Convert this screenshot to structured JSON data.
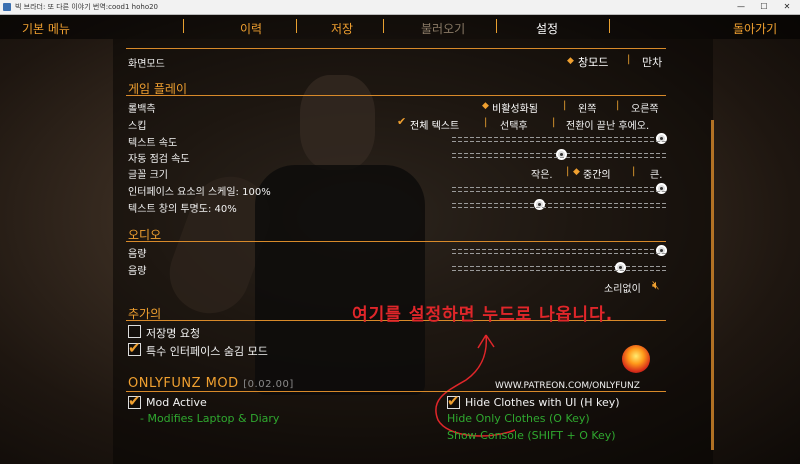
{
  "window": {
    "title": "빅 브라더: 또 다른 이야기  번역:cood1 hoho20",
    "minimize": "—",
    "maximize": "☐",
    "close": "✕"
  },
  "nav": {
    "main_menu": "기본 메뉴",
    "history": "이력",
    "save": "저장",
    "load": "불러오기",
    "settings": "설정",
    "back": "돌아가기",
    "separator": "|"
  },
  "display": {
    "label": "화면모드",
    "options": [
      "창모드",
      "만차"
    ],
    "selected": "창모드"
  },
  "gameplay": {
    "title": "게임 플레이",
    "rollback": {
      "label": "롤백측",
      "options": [
        "비활성화됨",
        "왼쪽",
        "오른쪽"
      ],
      "selected": "비활성화됨"
    },
    "skip": {
      "label": "스킵",
      "options": [
        "전체 텍스트",
        "선택후",
        "전환이 끝난 후에오."
      ],
      "selected": "전체 텍스트"
    },
    "text_speed": {
      "label": "텍스트 속도",
      "level": 1.0
    },
    "auto_speed": {
      "label": "자동 점검 속도",
      "level": 0.51
    },
    "font_size": {
      "label": "글꼴 크기",
      "options": [
        "작은.",
        "중간의",
        "큰."
      ],
      "selected": "중간의"
    },
    "ui_scale": {
      "label": "인터페이스 요소의 스케일: 100%",
      "level": 1.0
    },
    "text_opacity": {
      "label": "텍스트 창의 투명도: 40%",
      "level": 0.4
    }
  },
  "audio": {
    "title": "오디오",
    "volume1": {
      "label": "음량",
      "level": 1.0
    },
    "volume2": {
      "label": "음량",
      "level": 0.8
    },
    "mute_label": "소리없이",
    "mute_icon": "speaker-muted-icon"
  },
  "extras": {
    "title": "추가의",
    "confirm_save": {
      "label": "저장명 요청",
      "checked": false
    },
    "hide_special_ui": {
      "label": "특수 인터페이스 숨김 모드",
      "checked": true
    }
  },
  "annotation": "여기를 설정하면 누드로 나옵니다.",
  "mod": {
    "title": "ONLYFUNZ MOD",
    "version": "[0.02.00]",
    "patreon": "WWW.PATREON.COM/ONLYFUNZ",
    "mod_active": {
      "label": "Mod Active",
      "checked": true
    },
    "mod_active_desc": "- Modifies Laptop & Diary",
    "hide_clothes": {
      "label": "Hide Clothes with UI (H key)",
      "checked": true
    },
    "hide_only_clothes": "Hide Only Clothes (O Key)",
    "show_console": "Show Console (SHIFT + O Key)"
  },
  "colors": {
    "accent": "#f0a030",
    "annotation_red": "#e0262a",
    "mod_green": "#2fa82f"
  }
}
